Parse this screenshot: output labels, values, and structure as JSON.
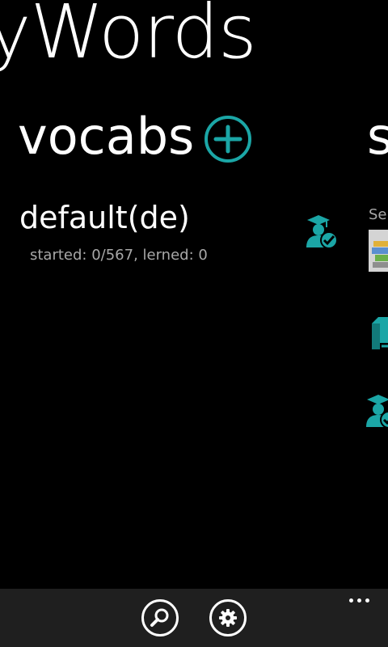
{
  "panorama": {
    "title": "yWords"
  },
  "vocabs_section": {
    "header": "vocabs",
    "add_icon": "add-circle-icon",
    "items": [
      {
        "name": "default(de)",
        "stats": "started: 0/567, lerned: 0",
        "icon": "learner-check-icon"
      }
    ]
  },
  "next_section": {
    "header": "s",
    "label": "Sel",
    "icons": [
      "books-thumbnail",
      "book-icon",
      "learner-check-icon"
    ]
  },
  "appbar": {
    "buttons": [
      {
        "icon": "search-icon"
      },
      {
        "icon": "settings-icon"
      }
    ],
    "more_icon": "ellipsis-icon"
  },
  "colors": {
    "accent": "#1ba6a6",
    "background": "#000000",
    "appbar": "#1f1f1f",
    "secondary_text": "#a8a8a8"
  }
}
